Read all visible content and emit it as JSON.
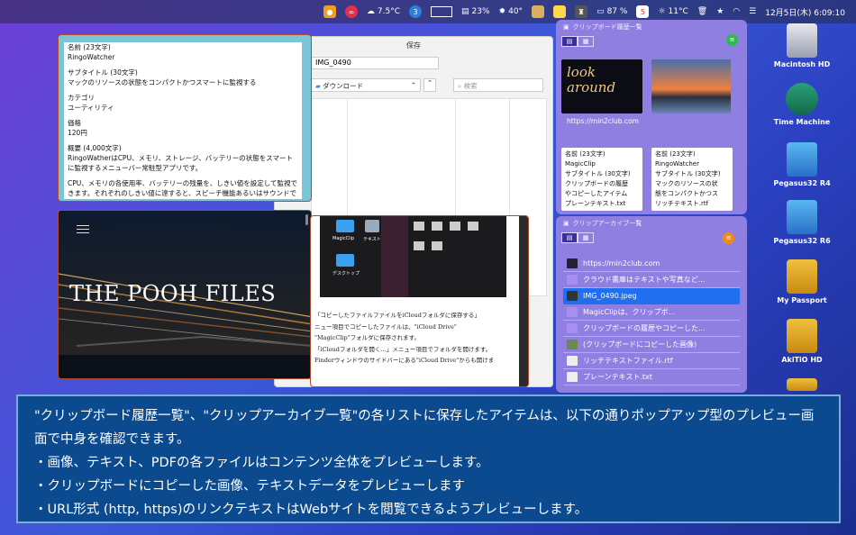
{
  "menubar": {
    "temp1": "7.5°C",
    "badge3": "3",
    "pct1": "23%",
    "temp2": "40°",
    "battery": "87 %",
    "temp3": "11°C",
    "datetime": "12月5日(木) 6:09:10"
  },
  "desktop": {
    "icons": [
      "Macintosh HD",
      "Time Machine",
      "Pegasus32 R4",
      "Pegasus32 R6",
      "My Passport",
      "AkiTiO HD"
    ]
  },
  "save_dialog": {
    "title": "保存",
    "filename": "IMG_0490",
    "location": "ダウンロード",
    "search_placeholder": "検索"
  },
  "text_preview": {
    "lines": [
      "名前 (23文字)",
      "RingoWatcher",
      "サブタイトル (30文字)",
      "マックのリソースの状態をコンパクトかつスマートに監視する",
      "カテゴリ",
      "ユーティリティ",
      "価格",
      "120円",
      "概要 (4,000文字)",
      "RingoWatherはCPU、メモリ、ストレージ、バッテリーの状態をスマートに監視するメニューバー常駐型アプリです。",
      "CPU、メモリの各使用率、バッテリーの残量を、しきい値を設定して監視できます。それぞれのしきい値に達すると、スピーチ機能あるいはサウンドで警告"
    ]
  },
  "image_preview": {
    "title": "THE POOH FILES"
  },
  "doc_preview": {
    "shot_labels": [
      "MagicClip",
      "テキスト",
      "デスクトップ"
    ],
    "lines": [
      "「コピーしたファイルファイルをiCloudフォルダに保存する」",
      "ニュー項目でコピーしたファイルは、\"iCloud Drive\"",
      "\"MagicClip\"フォルダに保存されます。",
      "「iCloudフォルダを開く…」メニュー項目でフォルダを開けます。",
      "Finderウィンドウのサイドバーにある\"iCloud Drive\"からも開けま"
    ]
  },
  "history_panel": {
    "title": "クリップボード履歴一覧",
    "thumb_text": "look around",
    "url": "https://min2club.com",
    "card1": [
      "名前 (23文字)",
      "MagicClip",
      "サブタイトル (30文字)",
      "クリップボードの履歴",
      "やコピーしたアイテム",
      "プレーンテキスト.txt"
    ],
    "card2": [
      "名前 (23文字)",
      "RingoWatcher",
      "サブタイトル (30文字)",
      "マックのリソースの状",
      "態をコンパクトかつス",
      "リッチテキスト.rtf"
    ]
  },
  "archive_panel": {
    "title": "クリップアーカイブ一覧",
    "items": [
      "https://min2club.com",
      "クラウド書庫はテキストや写真など...",
      "IMG_0490.jpeg",
      "MagicClipは、クリップボ...",
      "クリップボードの履歴やコピーした...",
      "(クリップボードにコピーした画像)",
      "リッチテキストファイル.rtf",
      "プレーンテキスト.txt"
    ],
    "selected_index": 2
  },
  "caption": {
    "lines": [
      "\"クリップボード履歴一覧\"、\"クリップアーカイブ一覧\"の各リストに保存したアイテムは、以下の通りポップアップ型のプレビュー画面で中身を確認できます。",
      "・画像、テキスト、PDFの各ファイルはコンテンツ全体をプレビューします。",
      "・クリップボードにコピーした画像、テキストデータをプレビューします",
      "・URL形式 (http, https)のリンクテキストはWebサイトを閲覧できるようプレビューします。"
    ]
  },
  "colors": {
    "selection": "#1f6ff0",
    "panel": "#8f7fe0",
    "caption_bg": "#0b4a8e",
    "accent_green": "#2fb84f",
    "accent_orange": "#f08a1c"
  }
}
